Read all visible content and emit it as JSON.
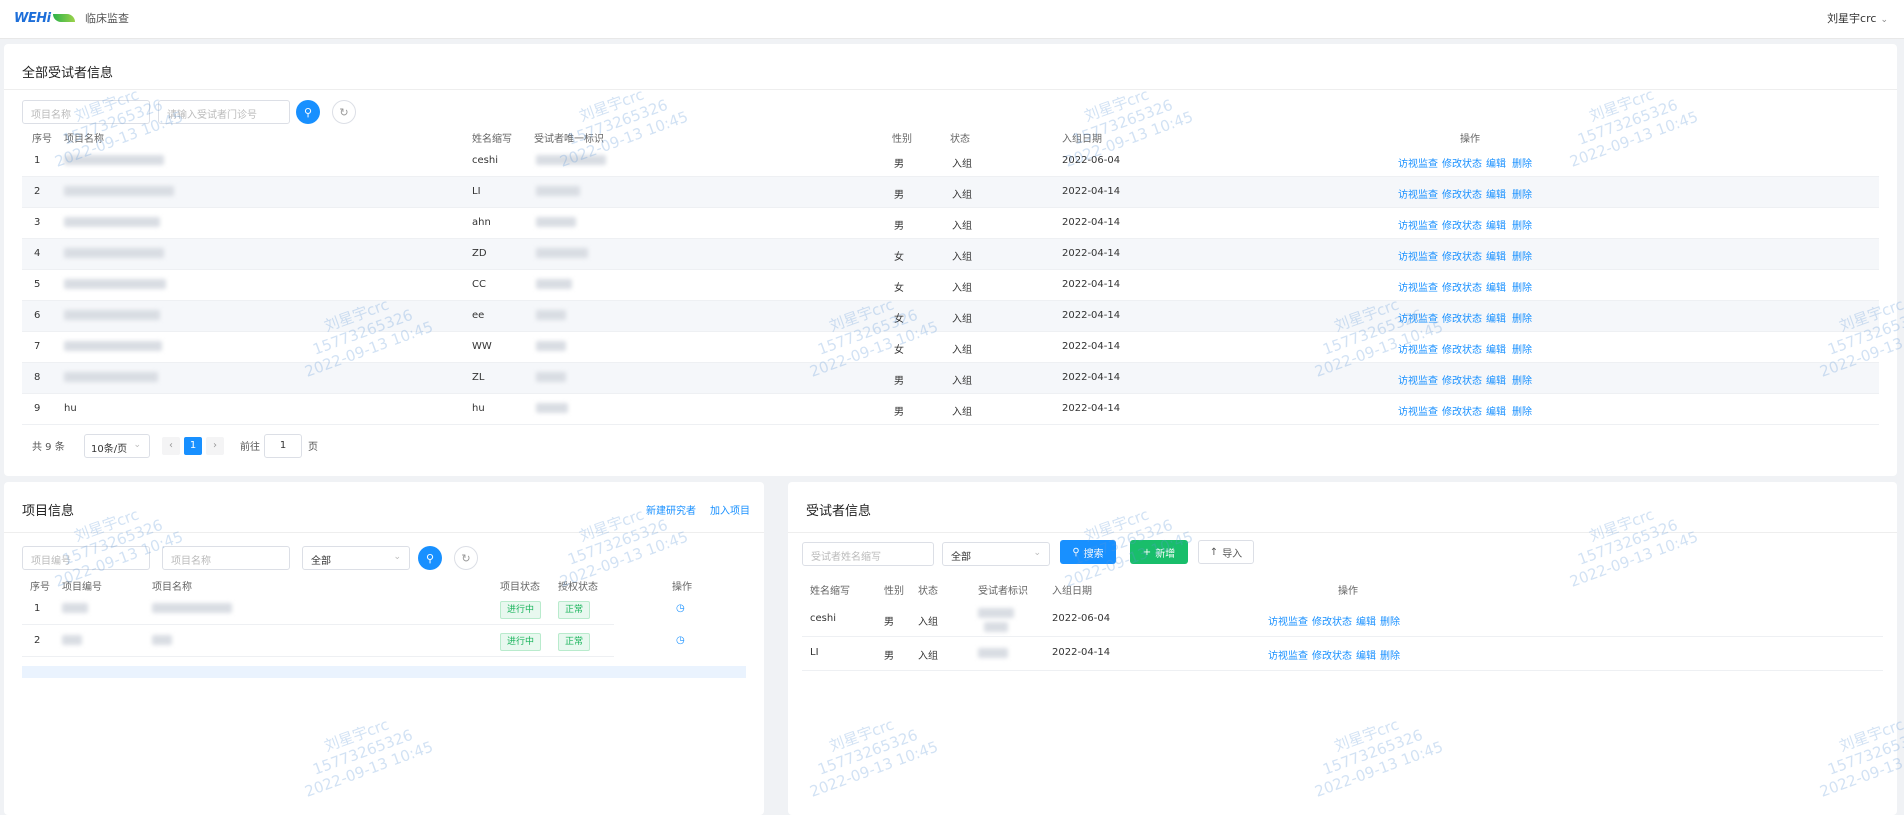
{
  "header": {
    "logo_text": "WEHi",
    "system_title": "临床监查",
    "user_name": "刘星宇crc"
  },
  "subjects_panel": {
    "title": "全部受试者信息",
    "search": {
      "project_placeholder": "项目名称",
      "id_placeholder": "请输入受试者门诊号"
    },
    "columns": [
      "序号",
      "项目名称",
      "姓名缩写",
      "受试者唯一标识",
      "性别",
      "状态",
      "入组日期",
      "操作"
    ],
    "rows": [
      {
        "index": "1",
        "abbr": "ceshi",
        "gender": "男",
        "status": "入组",
        "date": "2022-06-04"
      },
      {
        "index": "2",
        "abbr": "LI",
        "gender": "男",
        "status": "入组",
        "date": "2022-04-14"
      },
      {
        "index": "3",
        "abbr": "ahn",
        "gender": "男",
        "status": "入组",
        "date": "2022-04-14"
      },
      {
        "index": "4",
        "abbr": "ZD",
        "gender": "女",
        "status": "入组",
        "date": "2022-04-14"
      },
      {
        "index": "5",
        "abbr": "CC",
        "gender": "女",
        "status": "入组",
        "date": "2022-04-14"
      },
      {
        "index": "6",
        "abbr": "ee",
        "gender": "女",
        "status": "入组",
        "date": "2022-04-14"
      },
      {
        "index": "7",
        "abbr": "WW",
        "gender": "女",
        "status": "入组",
        "date": "2022-04-14"
      },
      {
        "index": "8",
        "abbr": "ZL",
        "gender": "男",
        "status": "入组",
        "date": "2022-04-14"
      },
      {
        "index": "9",
        "project": "hu",
        "abbr": "hu",
        "gender": "男",
        "status": "入组",
        "date": "2022-04-14"
      }
    ],
    "actions": [
      "访视监查",
      "修改状态",
      "编辑",
      "删除"
    ],
    "pagination": {
      "total": "共 9 条",
      "page_size": "10条/页",
      "prev": "‹",
      "current": "1",
      "next": "›",
      "goto_label": "前往",
      "goto_value": "1",
      "page_unit": "页"
    }
  },
  "project_panel": {
    "title": "项目信息",
    "link_new": "新建研究者",
    "link_join": "加入项目",
    "search": {
      "code_placeholder": "项目编号",
      "name_placeholder": "项目名称",
      "status_value": "全部"
    },
    "columns": [
      "序号",
      "项目编号",
      "项目名称",
      "项目状态",
      "授权状态",
      "操作"
    ],
    "rows": [
      {
        "index": "1",
        "status": "进行中",
        "auth": "正常"
      },
      {
        "index": "2",
        "status": "进行中",
        "auth": "正常"
      }
    ]
  },
  "subject_detail_panel": {
    "title": "受试者信息",
    "search_placeholder": "受试者姓名缩写",
    "status_value": "全部",
    "btn_search": "搜索",
    "btn_add": "新增",
    "btn_import": "导入",
    "columns": [
      "姓名缩写",
      "性别",
      "状态",
      "受试者标识",
      "入组日期",
      "操作"
    ],
    "rows": [
      {
        "abbr": "ceshi",
        "gender": "男",
        "status": "入组",
        "date": "2022-06-04"
      },
      {
        "abbr": "LI",
        "gender": "男",
        "status": "入组",
        "date": "2022-04-14"
      }
    ],
    "actions": [
      "访视监查",
      "修改状态",
      "编辑",
      "删除"
    ]
  },
  "watermark": {
    "name": "刘星宇crc",
    "phone": "15773265326",
    "time": "2022-09-13 10:45"
  },
  "colors": {
    "primary": "#1890ff",
    "success": "#19be6b",
    "background": "#f0f2f5"
  }
}
